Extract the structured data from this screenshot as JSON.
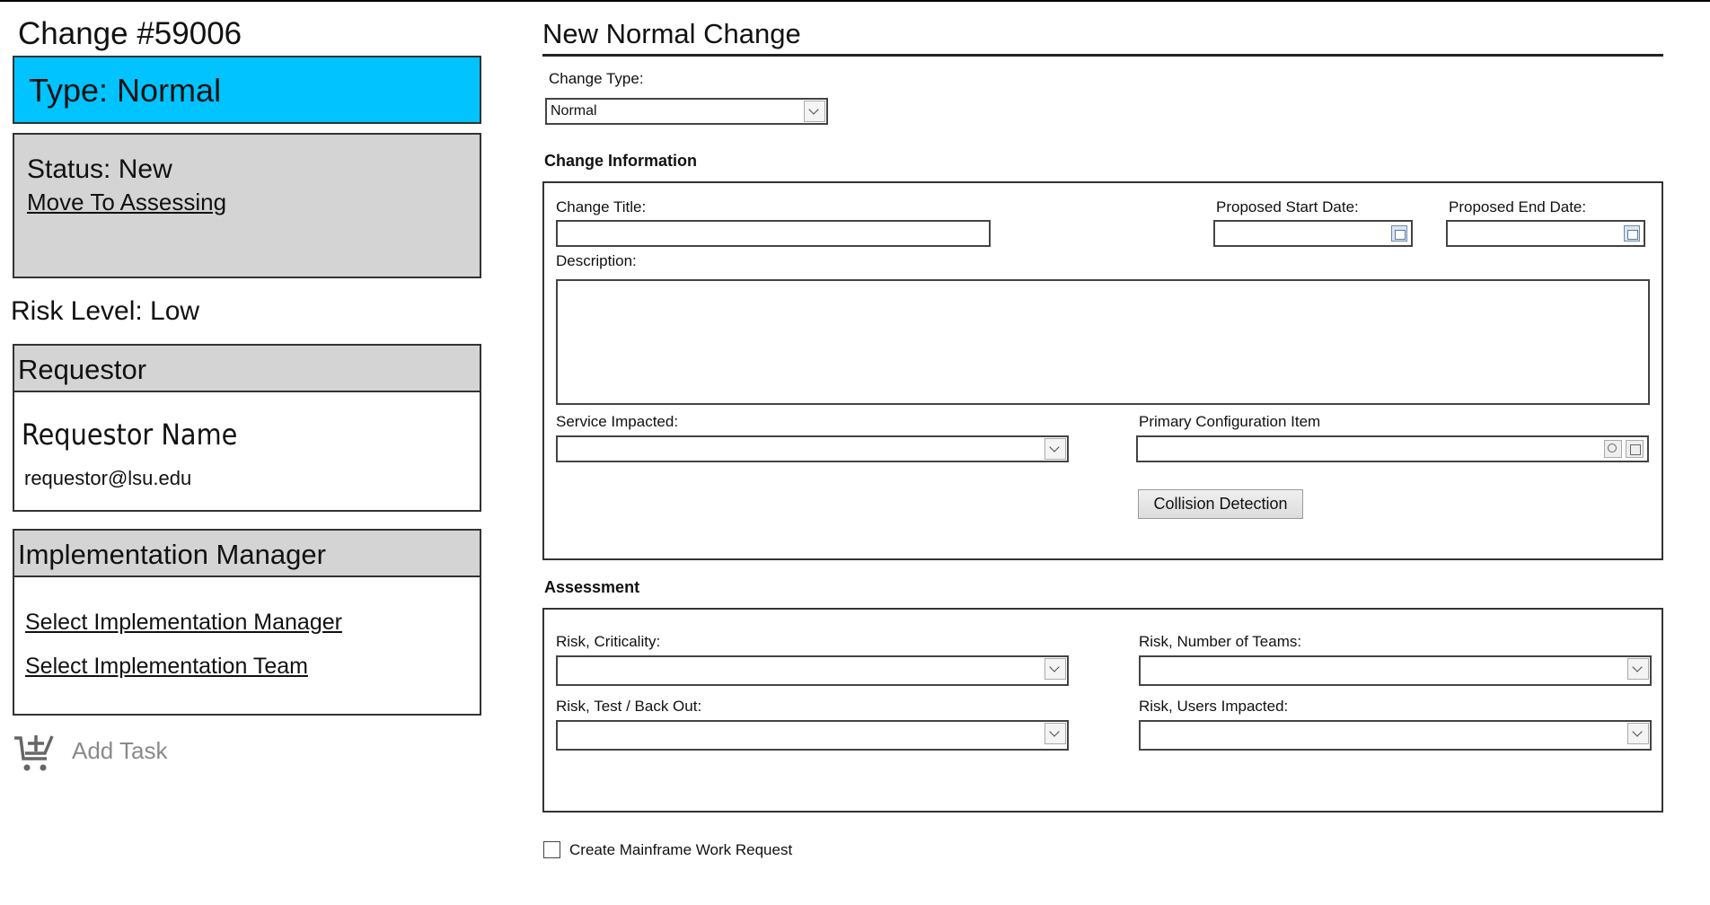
{
  "left": {
    "change_number": "Change #59006",
    "type_label": "Type: Normal",
    "status_label": "Status: New",
    "move_link": "Move To Assessing",
    "risk_level": "Risk Level: Low",
    "requestor": {
      "header": "Requestor",
      "name": "Requestor Name",
      "email": "requestor@lsu.edu"
    },
    "implementation": {
      "header": "Implementation Manager",
      "select_manager": "Select Implementation Manager",
      "select_team": "Select Implementation Team"
    },
    "add_task": "Add Task"
  },
  "form": {
    "title": "New Normal Change",
    "change_type": {
      "label": "Change Type:",
      "value": "Normal"
    },
    "change_info": {
      "heading": "Change Information",
      "change_title_label": "Change Title:",
      "proposed_start_label": "Proposed Start Date:",
      "proposed_end_label": "Proposed End Date:",
      "description_label": "Description:",
      "service_impacted_label": "Service Impacted:",
      "primary_ci_label": "Primary Configuration Item",
      "collision_button": "Collision Detection"
    },
    "assessment": {
      "heading": "Assessment",
      "risk_criticality_label": "Risk, Criticality:",
      "risk_teams_label": "Risk, Number of Teams:",
      "risk_test_label": "Risk, Test / Back Out:",
      "risk_users_label": "Risk, Users Impacted:"
    },
    "mainframe_checkbox_label": "Create Mainframe Work Request"
  },
  "colors": {
    "type_banner": "#00c3ff",
    "panel_header": "#d4d4d4"
  },
  "icons": [
    "add-task-cart-icon",
    "calendar-icon",
    "lookup-icon",
    "open-item-icon",
    "dropdown-arrow-icon"
  ]
}
